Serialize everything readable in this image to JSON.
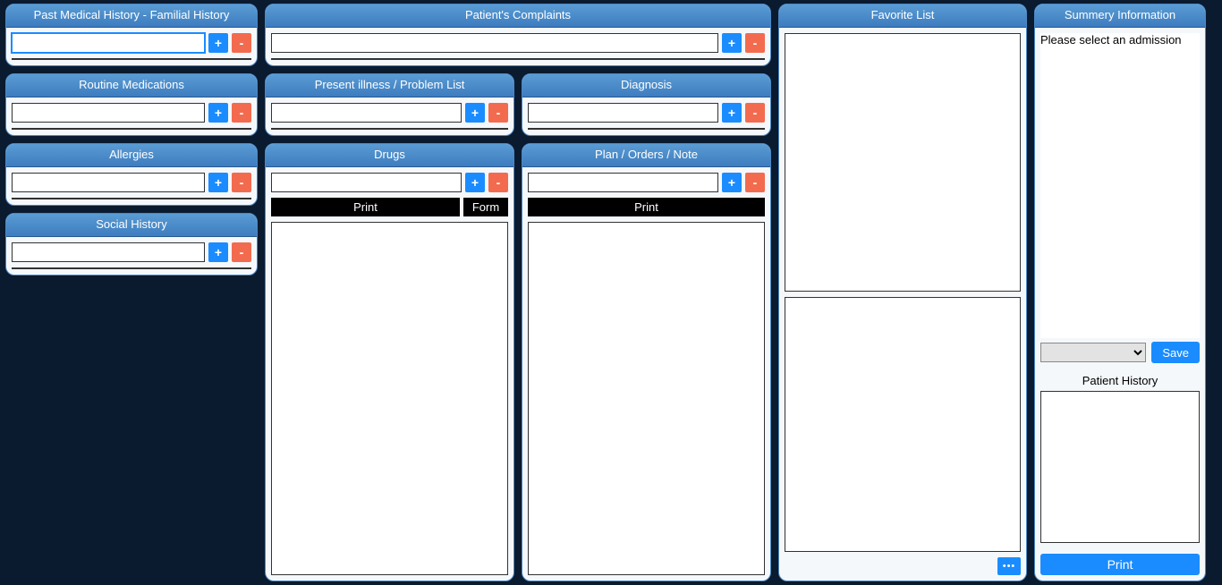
{
  "col1": {
    "pmh": {
      "title": "Past Medical History - Familial History",
      "add": "+",
      "remove": "-"
    },
    "rm": {
      "title": "Routine Medications",
      "add": "+",
      "remove": "-"
    },
    "al": {
      "title": "Allergies",
      "add": "+",
      "remove": "-"
    },
    "sh": {
      "title": "Social History",
      "add": "+",
      "remove": "-"
    }
  },
  "col2": {
    "pc": {
      "title": "Patient's Complaints",
      "add": "+",
      "remove": "-"
    },
    "pi": {
      "title": "Present illness / Problem List",
      "add": "+",
      "remove": "-"
    },
    "dg": {
      "title": "Diagnosis",
      "add": "+",
      "remove": "-"
    },
    "drugs": {
      "title": "Drugs",
      "add": "+",
      "remove": "-",
      "print": "Print",
      "form": "Form"
    },
    "plan": {
      "title": "Plan / Orders / Note",
      "add": "+",
      "remove": "-",
      "print": "Print"
    }
  },
  "col3": {
    "fav": {
      "title": "Favorite List",
      "dots": "•••"
    }
  },
  "col4": {
    "summary": {
      "title": "Summery Information",
      "message": "Please select an admission",
      "save": "Save",
      "ph_label": "Patient History",
      "print": "Print"
    }
  }
}
